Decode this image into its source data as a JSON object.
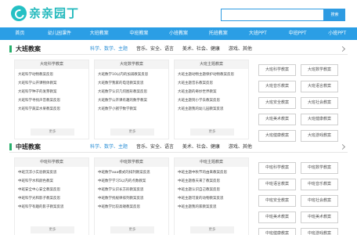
{
  "header": {
    "logo_text": "亲亲园丁",
    "search_placeholder": "",
    "search_button": "搜索"
  },
  "nav": [
    "首页",
    "幼儿园课件",
    "大班教案",
    "中班教案",
    "小班教案",
    "托班教案",
    "大班PPT",
    "中班PPT",
    "小班PPT"
  ],
  "sections": [
    {
      "title": "大班教案",
      "tags": [
        "科学、数学、主题",
        "音乐、安全、语言",
        "美术、社会、健康",
        "游戏、其他"
      ],
      "columns": [
        {
          "header": "大班科学教案",
          "items": [
            "大班科学动物教案反思",
            "大班科学公开课物体教案",
            "大班科学种子的发芽教案",
            "大班科学寻找声音教案反思",
            "大班科学蔬菜水果教案反思"
          ],
          "more": "更多"
        },
        {
          "header": "大班数学教案",
          "items": [
            "大班数学10以内的加减教案反思",
            "大班数学我家的电话教案反思",
            "大班数学认识几何图形教案反思",
            "大班数学公开课有趣的数字教案",
            "大班数学小猪学数学教案"
          ],
          "more": "更多"
        },
        {
          "header": "大班主题教案",
          "items": [
            "大班主题动物主题保护动物教案反思",
            "大班主题音乐教案反思",
            "大班主题的奇妙世界教案",
            "大班主题到小学去教案反思",
            "大班主题我的幼儿园教案反思"
          ],
          "more": "更多"
        }
      ],
      "buttons": [
        "大班科学教案",
        "大班数学教案",
        "大班音乐教案",
        "大班语言教案",
        "大班安全教案",
        "大班社会教案",
        "大班美术教案",
        "大班健康教案",
        "大班健康教案",
        "大班游戏教案"
      ]
    },
    {
      "title": "中班教案",
      "tags": [
        "科学、数学、主题",
        "音乐、安全、语言",
        "美术、社会、健康",
        "游戏、其他"
      ],
      "columns": [
        {
          "header": "中班科学教案",
          "items": [
            "中班沉浮小实验教案反思",
            "中班科学水和颜色教案",
            "中班安全中心安全教案反思",
            "中班科学光和影子教案反思",
            "中班科学有趣的影子教案反思"
          ],
          "more": "更多"
        },
        {
          "header": "中班数学教案",
          "items": [
            "中班数学aaa模式的排列教案反思",
            "中班数学学习5以内的点数教案",
            "中班数学认识长方形教案反思",
            "中班数学找规律排列教案反思",
            "中班数学比较高矮教案反思"
          ],
          "more": "更多"
        },
        {
          "header": "中班主题教案",
          "items": [
            "中班主题中秋节的由来教案反思",
            "中班主题春天来了教案反思",
            "中班主题认识自己教案反思",
            "中班主题可爱的动物教案反思",
            "中班主题我的家教案反思"
          ],
          "more": "更多"
        }
      ],
      "buttons": [
        "中班科学教案",
        "中班数学教案",
        "中班语言教案",
        "中班音乐教案",
        "中班安全教案",
        "中班社会教案",
        "中班美术教案",
        "中班美术教案",
        "中班健康教案",
        "中班游戏教案"
      ]
    }
  ],
  "colors": {
    "brand": "#24c0c4",
    "nav_bg": "#2b9ee5",
    "accent_bar": "#28b06c",
    "tag_highlight": "#2b8fd6"
  }
}
